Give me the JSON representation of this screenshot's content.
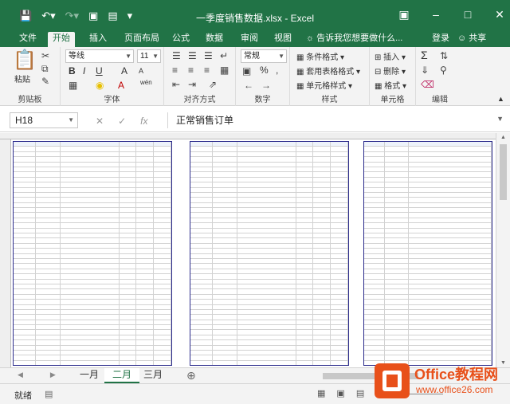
{
  "window": {
    "title": "一季度销售数据.xlsx - Excel",
    "qat_icons": [
      "save-icon",
      "undo-icon",
      "redo-icon",
      "camera-icon",
      "form-icon",
      "customize-icon"
    ]
  },
  "menu": {
    "tabs": [
      "文件",
      "开始",
      "插入",
      "页面布局",
      "公式",
      "数据",
      "审阅",
      "视图"
    ],
    "active": "开始",
    "tell_me": "告诉我您想要做什么...",
    "login": "登录",
    "share": "共享"
  },
  "ribbon": {
    "clipboard": {
      "label": "剪贴板",
      "paste": "粘贴"
    },
    "font": {
      "label": "字体",
      "name": "等线",
      "size": "11",
      "bold": "B",
      "italic": "I",
      "underline": "U",
      "grow": "A",
      "shrink": "A",
      "phonetic": "wén"
    },
    "alignment": {
      "label": "对齐方式"
    },
    "number": {
      "label": "数字",
      "format": "常规",
      "percent": "%",
      "comma": ","
    },
    "styles": {
      "label": "样式",
      "conditional": "条件格式",
      "table": "套用表格格式",
      "cell": "单元格样式"
    },
    "cells": {
      "label": "单元格",
      "insert": "插入",
      "delete": "删除",
      "format": "格式"
    },
    "editing": {
      "label": "编辑"
    }
  },
  "formula_bar": {
    "name_box": "H18",
    "content": "正常销售订单"
  },
  "sheets": {
    "tabs": [
      "一月",
      "二月",
      "三月"
    ],
    "active": "二月"
  },
  "status": {
    "text": "就绪"
  },
  "logo": {
    "brand": "Office教程网",
    "url": "www.office26.com"
  }
}
